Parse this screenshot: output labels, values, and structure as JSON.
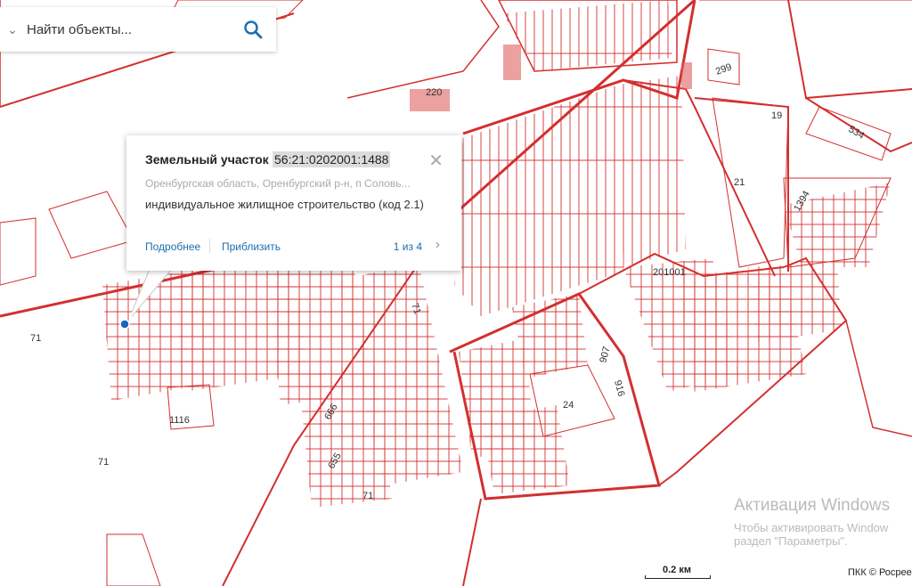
{
  "search": {
    "placeholder": "Найти объекты...",
    "chevron_icon": "chevron-down-icon",
    "search_icon": "search-icon"
  },
  "popup": {
    "title": "Земельный участок",
    "cadastral_number": "56:21:0202001:1488",
    "address": "Оренбургская область, Оренбургский р-н, п Соловь...",
    "permitted_use": "индивидуальное жилищное строительство (код 2.1)",
    "more_link": "Подробнее",
    "zoom_link": "Приблизить",
    "pager": "1 из 4",
    "close_icon": "close-icon",
    "next_icon": "chevron-right-icon"
  },
  "map_labels": {
    "l220": "220",
    "l299": "299",
    "l19": "19",
    "l534": "534",
    "l21": "21",
    "l1394": "1394",
    "l201001": "201001",
    "l71a": "71",
    "l71b": "71",
    "l71c": "71",
    "l71d": "71",
    "l1116": "1116",
    "l666": "666",
    "l655": "655",
    "l907": "907",
    "l916": "916",
    "l24": "24"
  },
  "watermark": {
    "line1": "Активация Windows",
    "line2": "Чтобы активировать Window",
    "line3": "раздел \"Параметры\"."
  },
  "scale": {
    "label": "0.2 км"
  },
  "copyright": "ПКК © Росрее",
  "colors": {
    "parcel_red": "#d32f2f",
    "link_blue": "#1a6fb0",
    "marker_blue": "#1565c0"
  }
}
